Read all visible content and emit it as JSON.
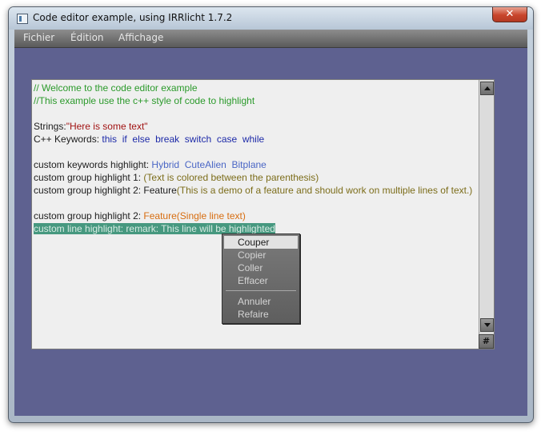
{
  "window": {
    "title": "Code editor example, using IRRlicht 1.7.2",
    "close_glyph": "✕"
  },
  "menubar": {
    "items": [
      "Fichier",
      "Édition",
      "Affichage"
    ]
  },
  "editor": {
    "lines": {
      "l1": "// Welcome to the code editor example",
      "l2": "//This example use the c++ style of code to highlight",
      "l4_label": "Strings:",
      "l4_string": "\"Here is some text\"",
      "l5_label": "C++ Keywords: ",
      "l5_keywords": [
        "this",
        "if",
        "else",
        "break",
        "switch",
        "case",
        "while"
      ],
      "l7_label": "custom keywords highlight: ",
      "l7_keywords": [
        "Hybrid",
        "CuteAlien",
        "Bitplane"
      ],
      "l8_label": "custom group highlight 1: ",
      "l8_group": "(Text is colored between the parenthesis)",
      "l9_label": "custom group highlight 2: Feature",
      "l9_group": "(This is a demo of a feature and should work on multiple lines of text.)",
      "l10_label": "custom group highlight 2: ",
      "l10_group": "Feature(Single line text)",
      "l11": "custom line highlight: remark: This line will be highlighted"
    },
    "corner_glyph": "#"
  },
  "context_menu": {
    "items": [
      "Couper",
      "Copier",
      "Coller",
      "Effacer",
      "Annuler",
      "Refaire"
    ],
    "active_index": 0
  },
  "colors": {
    "comment": "#2b9a2b",
    "string": "#a11313",
    "keyword": "#1d2aa8",
    "custom_keyword": "#4a66c5",
    "group": "#7c6d1a",
    "feature": "#d76d10",
    "line_highlight": "#46987f",
    "client_background": "#5e6190"
  },
  "icons": [
    "app-window-icon",
    "close-icon",
    "scroll-up-icon",
    "scroll-down-icon"
  ]
}
